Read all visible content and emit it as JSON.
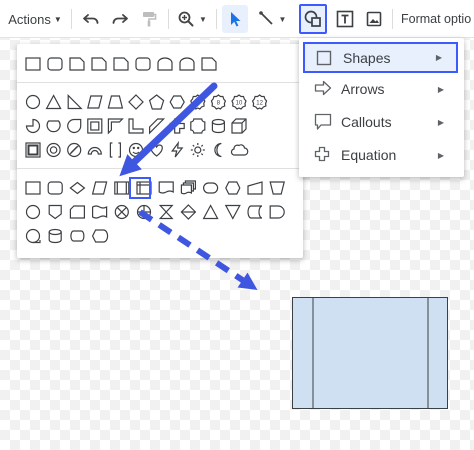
{
  "toolbar": {
    "actions_label": "Actions",
    "format_options_label": "Format optio"
  },
  "submenu": {
    "items": [
      {
        "label": "Shapes"
      },
      {
        "label": "Arrows"
      },
      {
        "label": "Callouts"
      },
      {
        "label": "Equation"
      }
    ]
  },
  "colors": {
    "highlight": "#3d5afe",
    "arrow": "#3f56e0",
    "shape_fill": "#cfe0f3"
  }
}
